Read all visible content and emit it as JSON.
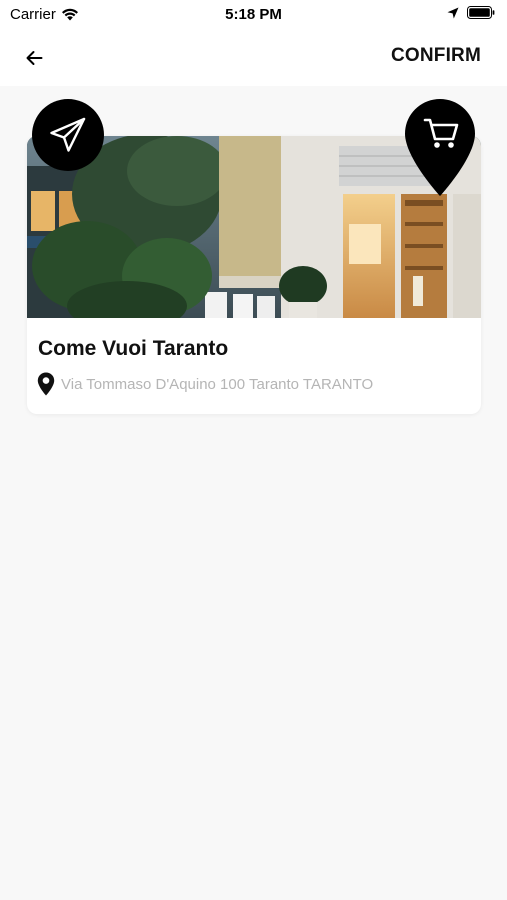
{
  "status_bar": {
    "carrier": "Carrier",
    "time": "5:18 PM"
  },
  "nav": {
    "back_icon": "arrow-left-icon",
    "confirm_label": "CONFIRM"
  },
  "store": {
    "name": "Come Vuoi Taranto",
    "address": "Via Tommaso D'Aquino 100 Taranto TARANTO",
    "send_icon": "paper-plane-icon",
    "pin_icon": "cart-pin-icon"
  },
  "colors": {
    "background": "#f8f8f8",
    "card": "#ffffff",
    "accent": "#000000",
    "address_text": "#b5b5b5"
  }
}
